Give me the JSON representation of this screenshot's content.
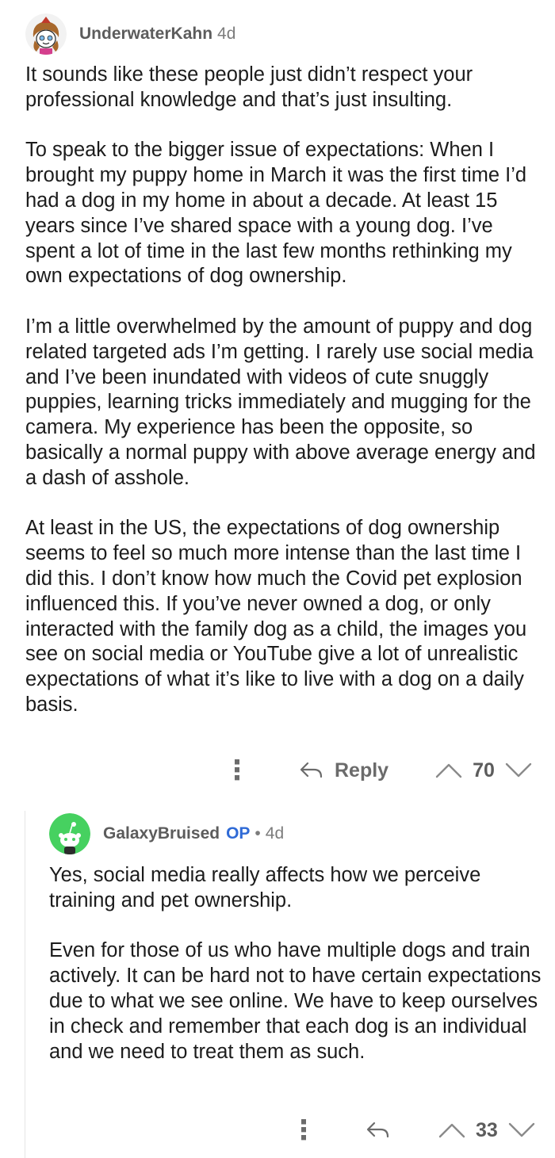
{
  "comments": [
    {
      "username": "UnderwaterKahn",
      "age": "4d",
      "paragraphs": [
        "It sounds like these people just didn’t respect your professional knowledge and that’s just insulting.",
        "To speak to the bigger issue of expectations: When I brought my puppy home in March it was the first time I’d had a dog in my home in about a decade. At least 15 years since I’ve shared space with a young dog. I’ve spent a lot of time in the last few months rethinking my own expectations of dog ownership.",
        "I’m a little overwhelmed by the amount of puppy and dog related targeted ads I’m getting. I rarely use social media and I’ve been inundated with videos of cute snuggly puppies, learning tricks immediately and mugging for the camera. My experience has been the opposite, so basically a normal puppy with above average energy and a dash of asshole.",
        "At least in the US, the expectations of dog ownership seems to feel so much more intense than the last time I did this. I don’t know how much the Covid pet explosion influenced this. If you’ve never owned a dog, or only interacted with the family dog as a child, the images you see on social media or YouTube give a lot of unrealistic expectations of what it’s like to live with a dog on a daily basis."
      ],
      "actions": {
        "more": "⋮",
        "reply": "Reply",
        "score": "70"
      }
    },
    {
      "username": "GalaxyBruised",
      "badge": "OP",
      "separator": "•",
      "age": "4d",
      "paragraphs": [
        "Yes, social media really affects how we perceive training and pet ownership.",
        "Even for those of us who have multiple dogs and train actively. It can be hard not to have certain expectations due to what we see online. We have to keep ourselves in check and remember that each dog is an individual and we need to treat them as such."
      ],
      "actions": {
        "more": "⋮",
        "score": "33"
      }
    }
  ],
  "colors": {
    "op_badge": "#2f6ad6",
    "meta_gray": "#7c7c7c",
    "avatar_green": "#46d160"
  },
  "icons": {
    "reply": "reply-arrow-icon",
    "upvote": "upvote-chevron-icon",
    "downvote": "downvote-chevron-icon",
    "more": "kebab-menu-icon"
  }
}
